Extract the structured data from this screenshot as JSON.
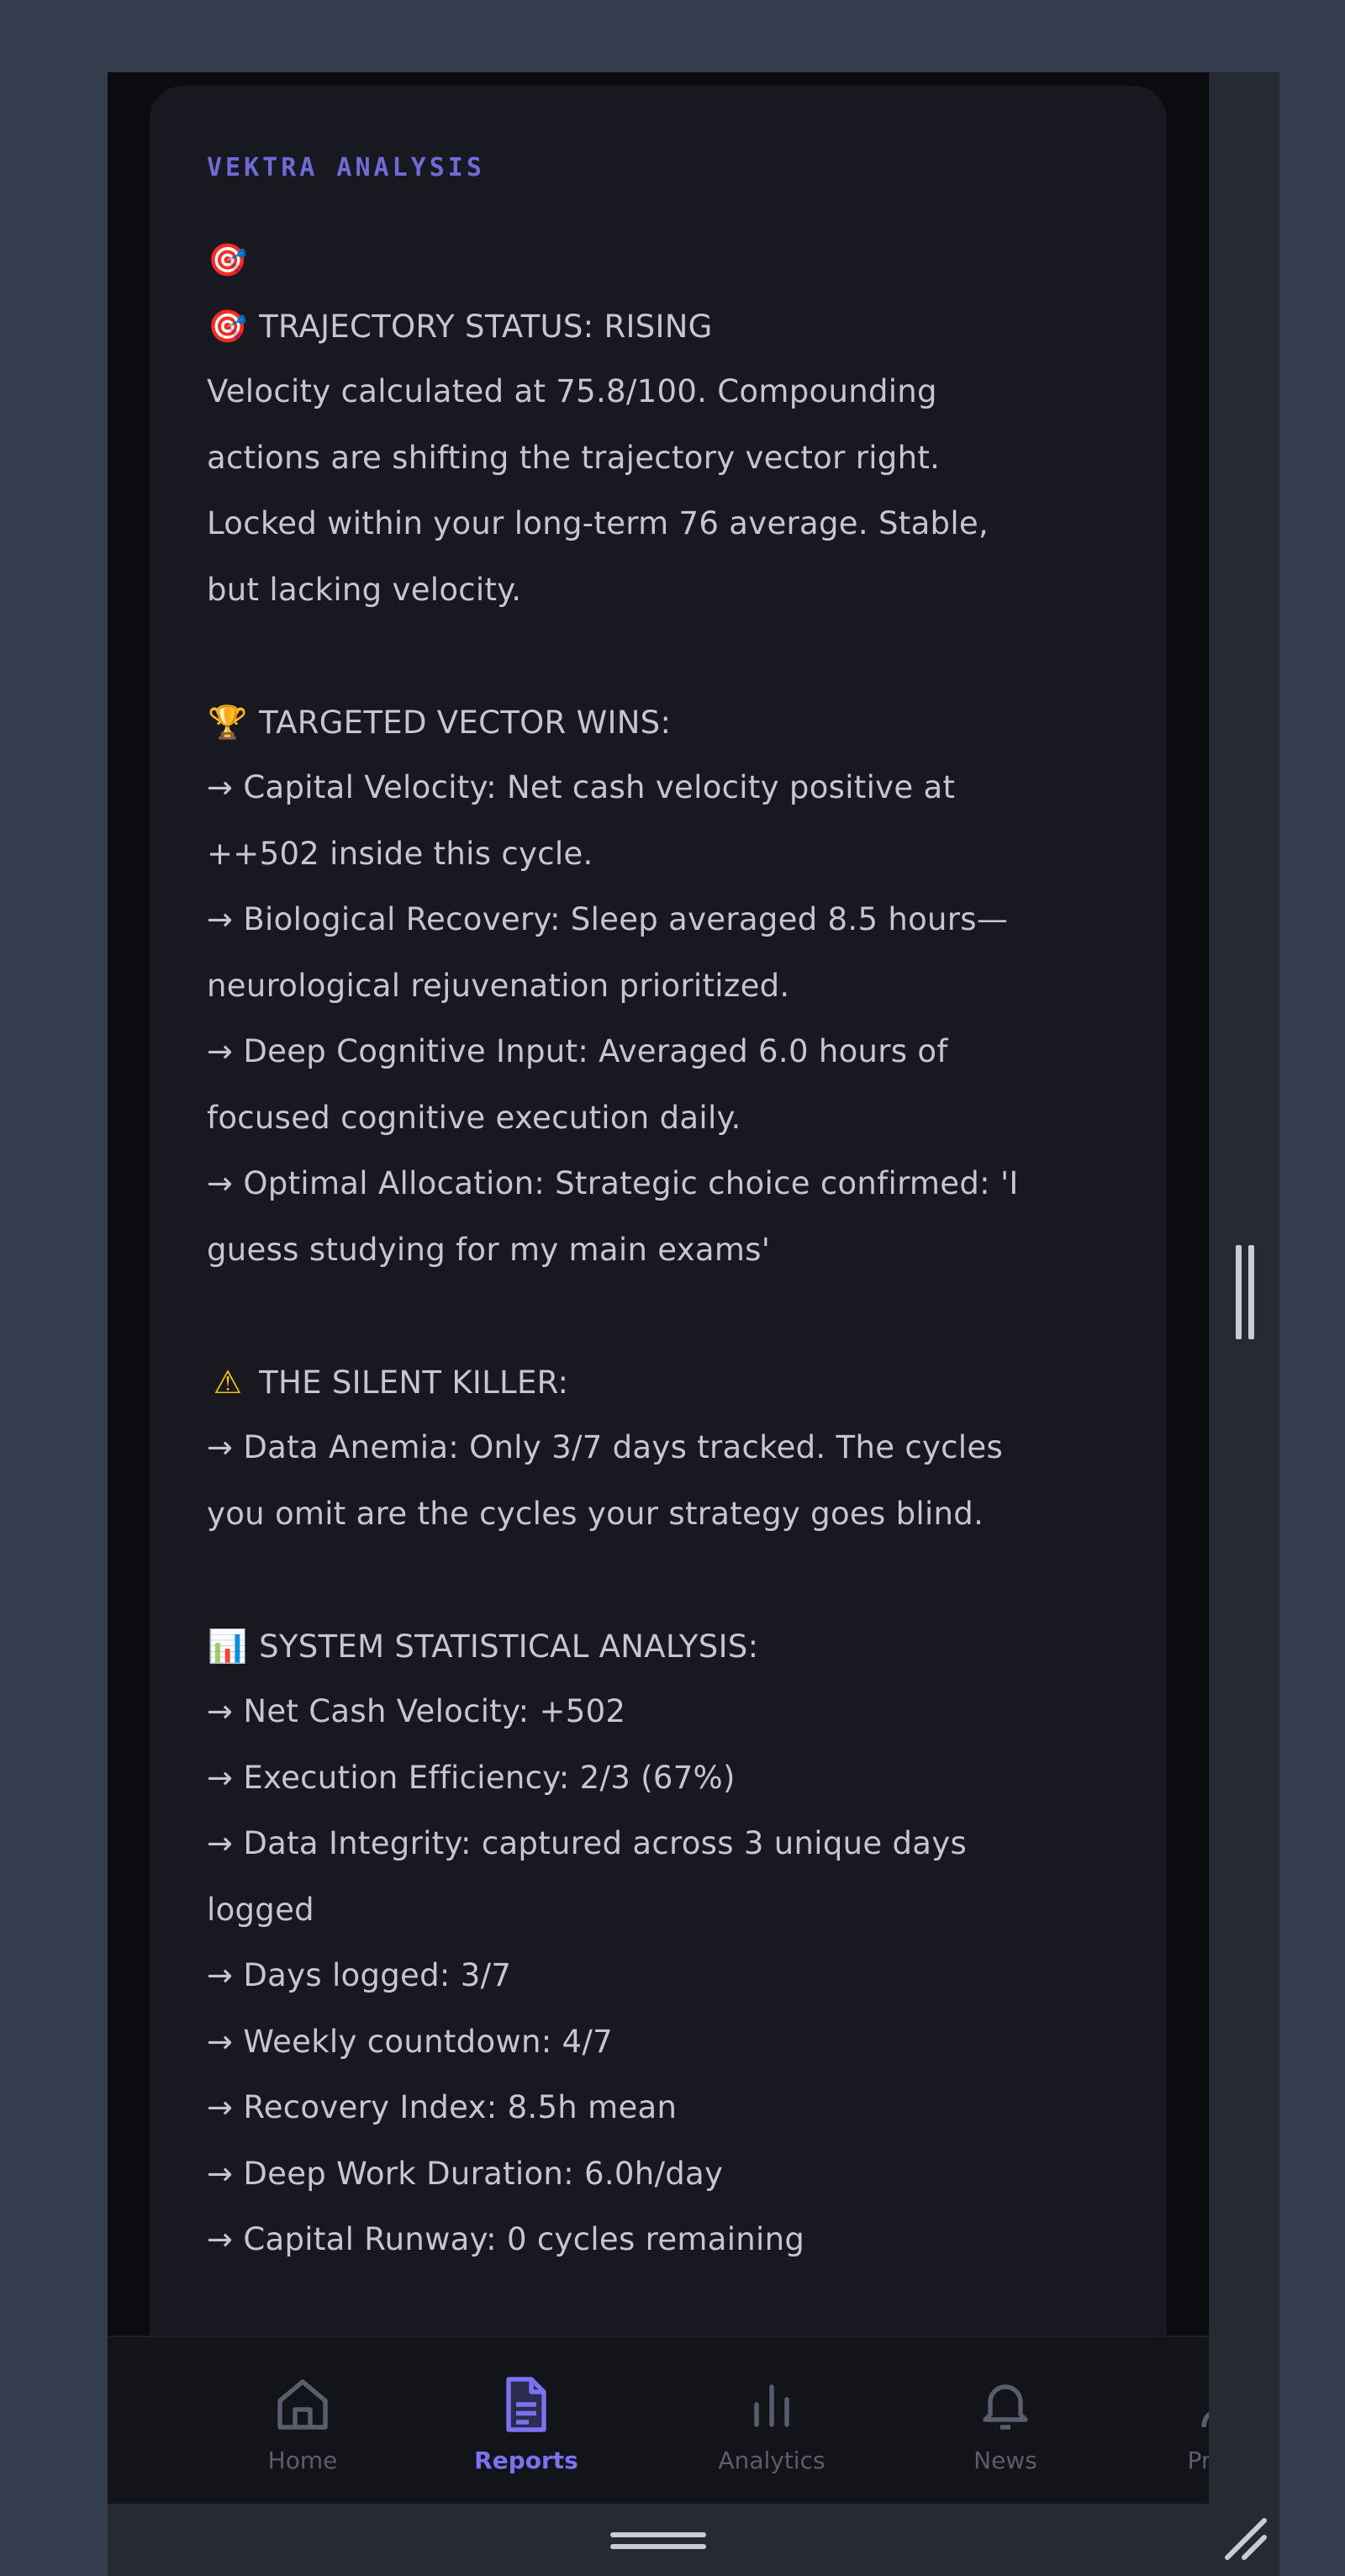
{
  "card": {
    "header": "VEKTRA ANALYSIS",
    "lines": [
      {
        "emoji": "🎯",
        "emoji_name": "target-icon",
        "text": ""
      },
      {
        "emoji": "🎯",
        "emoji_name": "target-icon",
        "text": "TRAJECTORY STATUS: RISING"
      },
      {
        "text": "Velocity calculated at 75.8/100. Compounding"
      },
      {
        "text": "actions are shifting the trajectory vector right."
      },
      {
        "text": " Locked within your long-term 76 average. Stable,"
      },
      {
        "text": "but lacking velocity."
      },
      {
        "blank": true
      },
      {
        "emoji": "🏆",
        "emoji_name": "trophy-icon",
        "text": "TARGETED VECTOR WINS:"
      },
      {
        "text": "→ Capital Velocity: Net cash velocity positive at"
      },
      {
        "text": "++502 inside this cycle."
      },
      {
        "text": "→ Biological Recovery: Sleep averaged 8.5 hours—"
      },
      {
        "text": "neurological rejuvenation prioritized."
      },
      {
        "text": "→ Deep Cognitive Input: Averaged 6.0 hours of"
      },
      {
        "text": "focused cognitive execution daily."
      },
      {
        "text": "→ Optimal Allocation: Strategic choice confirmed: 'I"
      },
      {
        "text": "guess studying for my main exams'"
      },
      {
        "blank": true
      },
      {
        "emoji": "⚠",
        "emoji_name": "warning-icon",
        "text": "THE SILENT KILLER:"
      },
      {
        "text": "→ Data Anemia: Only 3/7 days tracked. The cycles"
      },
      {
        "text": "you omit are the cycles your strategy goes blind."
      },
      {
        "blank": true
      },
      {
        "emoji": "📊",
        "emoji_name": "bar-chart-icon",
        "text": "SYSTEM STATISTICAL ANALYSIS:"
      },
      {
        "text": "→ Net Cash Velocity: +502"
      },
      {
        "text": "→ Execution Efficiency: 2/3 (67%)"
      },
      {
        "text": "→ Data Integrity: captured across 3 unique days"
      },
      {
        "text": "logged"
      },
      {
        "text": "→ Days logged: 3/7"
      },
      {
        "text": "→ Weekly countdown: 4/7"
      },
      {
        "text": "→ Recovery Index: 8.5h mean"
      },
      {
        "text": "→ Deep Work Duration: 6.0h/day"
      },
      {
        "text": "→ Capital Runway: 0 cycles remaining"
      }
    ]
  },
  "nav": {
    "items": [
      {
        "label": "Home",
        "icon": "home-icon",
        "active": false
      },
      {
        "label": "Reports",
        "icon": "document-icon",
        "active": true
      },
      {
        "label": "Analytics",
        "icon": "bar-chart-icon",
        "active": false
      },
      {
        "label": "News",
        "icon": "bell-icon",
        "active": false
      },
      {
        "label": "Profile",
        "icon": "user-icon",
        "active": false
      }
    ]
  },
  "colors": {
    "accent": "#7b72f2",
    "background": "#343d4d",
    "card": "#181920",
    "nav_inactive": "#5a5e6c"
  }
}
